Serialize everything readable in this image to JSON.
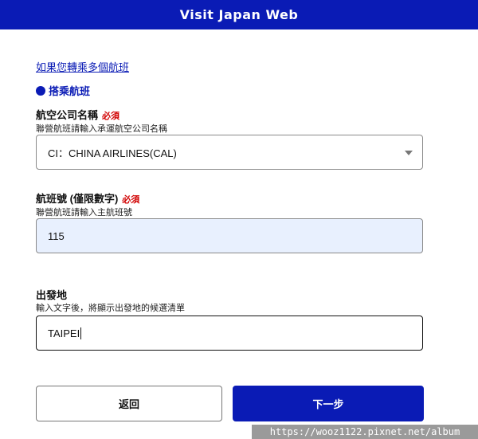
{
  "header": {
    "title": "Visit Japan Web"
  },
  "transfer_link": "如果您轉乘多個航班",
  "section_title": "搭乘航班",
  "airline": {
    "label": "航空公司名稱",
    "required": "必須",
    "hint": "聯營航班請輸入承運航空公司名稱",
    "value": "CI：CHINA AIRLINES(CAL)"
  },
  "flight_no": {
    "label": "航班號 (僅限數字)",
    "required": "必須",
    "hint": "聯營航班請輸入主航班號",
    "value": "115"
  },
  "departure": {
    "label": "出發地",
    "hint": "輸入文字後，將顯示出發地的候選清單",
    "value": "TAIPEI"
  },
  "buttons": {
    "back": "返回",
    "next": "下一步"
  },
  "watermark": "https://wooz1122.pixnet.net/album",
  "colors": {
    "brand": "#0a1bb5",
    "required": "#d10000",
    "autofill": "#e8f0fe"
  }
}
